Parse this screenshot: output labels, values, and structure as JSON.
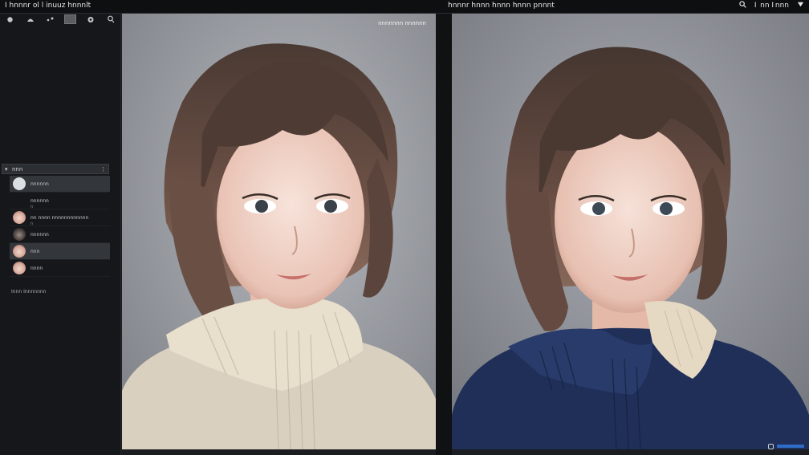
{
  "window": {
    "left_title": "I  hnnnr  ol l inuuz  hnnnlt",
    "right_title": "hnnnr  hnnn  hnnn  hnnn  pnnnt",
    "right_status": "I  nn  I nnn"
  },
  "sidebar": {
    "tools": [
      {
        "icon": "circle-tool-icon"
      },
      {
        "icon": "brush-tool-icon"
      },
      {
        "icon": "dots-tool-icon"
      },
      {
        "icon": "square-tool-icon"
      },
      {
        "icon": "camera-tool-icon"
      },
      {
        "icon": "lasso-tool-icon"
      }
    ],
    "layers_title": "nnn",
    "layers": [
      {
        "label": "nnnnnn",
        "sub": "",
        "selected": true
      },
      {
        "label": "nnnnnn",
        "sub": "n",
        "selected": false
      },
      {
        "label": "nn nnnn nnnnnnnnnnnn",
        "sub": "n",
        "selected": false
      },
      {
        "label": "nnnnnn",
        "sub": "",
        "selected": false
      },
      {
        "label": "nnn",
        "sub": "",
        "selected": true
      },
      {
        "label": "nnnn",
        "sub": "",
        "selected": false
      }
    ],
    "footer": "Innn Innnnnnn"
  },
  "panels": {
    "left": {
      "label": "nnnnnnn nnnnnn",
      "sweater_color": "#d9d0bf"
    },
    "right": {
      "label": "",
      "sweater_color": "#1f2f57"
    }
  },
  "colors": {
    "topbar": "#0e0f11",
    "sidebar": "#15171a",
    "accent": "#2f6cc7"
  }
}
